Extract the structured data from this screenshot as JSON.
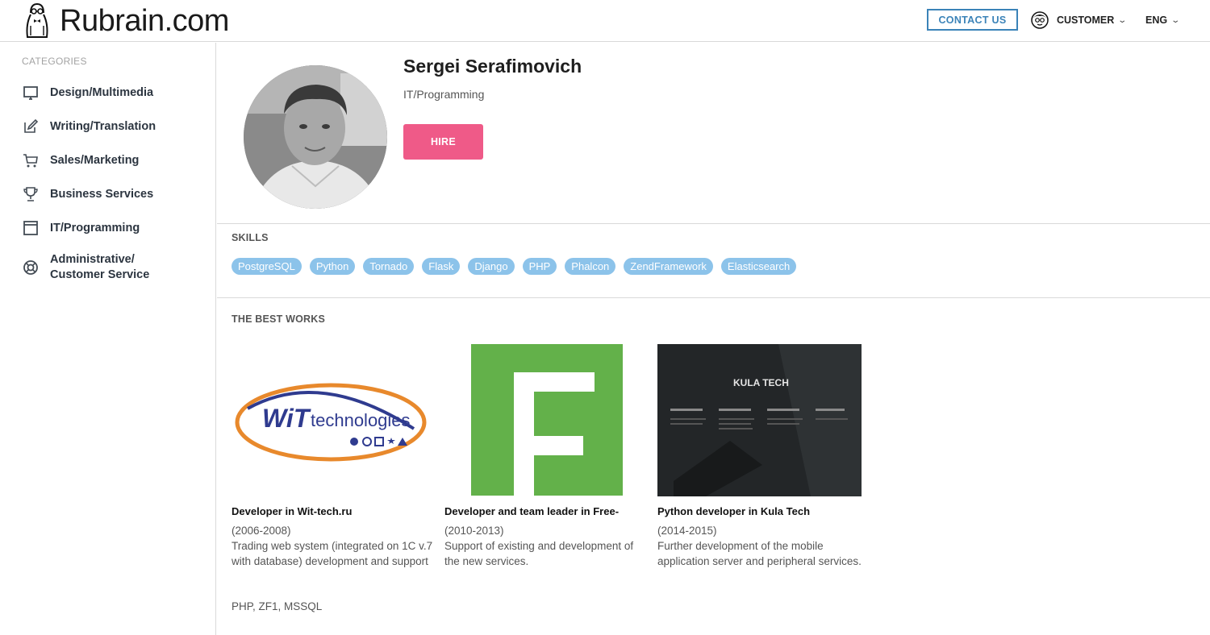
{
  "header": {
    "site_name": "Rubrain.com",
    "contact_label": "CONTACT US",
    "customer_label": "CUSTOMER",
    "lang_label": "ENG"
  },
  "sidebar": {
    "title": "CATEGORIES",
    "items": [
      {
        "label": "Design/Multimedia",
        "icon": "monitor-icon"
      },
      {
        "label": "Writing/Translation",
        "icon": "edit-icon"
      },
      {
        "label": "Sales/Marketing",
        "icon": "cart-icon"
      },
      {
        "label": "Business Services",
        "icon": "trophy-icon"
      },
      {
        "label": "IT/Programming",
        "icon": "window-icon"
      },
      {
        "label": "Administrative/\nCustomer Service",
        "line1": "Administrative/",
        "line2": "Customer Service",
        "icon": "lifebuoy-icon"
      }
    ]
  },
  "profile": {
    "name": "Sergei Serafimovich",
    "role": "IT/Programming",
    "hire_label": "HIRE"
  },
  "skills": {
    "title": "SKILLS",
    "items": [
      "PostgreSQL",
      "Python",
      "Tornado",
      "Flask",
      "Django",
      "PHP",
      "Phalcon",
      "ZendFramework",
      "Elasticsearch"
    ]
  },
  "works": {
    "title": "THE BEST WORKS",
    "items": [
      {
        "title": "Developer in Wit-tech.ru",
        "years": "(2006-2008)",
        "desc_line1": "Trading web system (integrated on 1C v.7",
        "desc_line2": "with database) development and support",
        "logo_text1": "WiT",
        "logo_text2": "technologies"
      },
      {
        "title": "Developer and team leader in Free-",
        "years": "(2010-2013)",
        "desc_line1": "Support of existing and development of",
        "desc_line2": "the new services."
      },
      {
        "title": "Python developer in Kula Tech",
        "years": "(2014-2015)",
        "desc_line1": "Further development of the mobile",
        "desc_line2": "application server and peripheral services.",
        "logo_text": "KULA TECH"
      }
    ],
    "tech": "PHP, ZF1, MSSQL"
  },
  "colors": {
    "accent_blue": "#3b83b8",
    "hire_pink": "#ef5a88",
    "skill_blue": "#8cc3ea",
    "free_green": "#63b14a"
  }
}
